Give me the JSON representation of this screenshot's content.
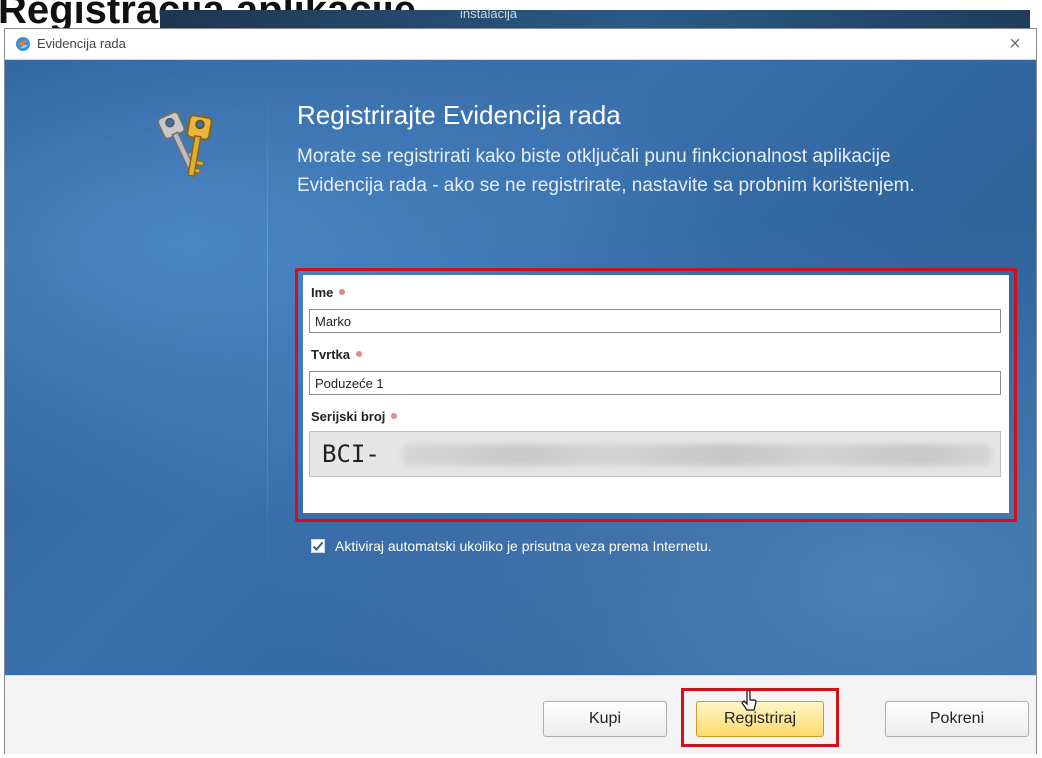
{
  "background": {
    "heading": "Registracija aplikacije",
    "tab_text": "instalacija"
  },
  "window": {
    "title": "Evidencija rada",
    "close_glyph": "×"
  },
  "dialog": {
    "heading": "Registrirajte Evidencija rada",
    "description": "Morate se registrirati kako biste otključali punu finkcionalnost aplikacije Evidencija rada - ako se ne registrirate, nastavite sa probnim korištenjem."
  },
  "form": {
    "name_label": "Ime",
    "name_value": "Marko",
    "company_label": "Tvrtka",
    "company_value": "Poduzeće 1",
    "serial_label": "Serijski broj",
    "serial_prefix": "BCI-"
  },
  "checkbox": {
    "label": "Aktiviraj automatski ukoliko je prisutna veza prema Internetu.",
    "checked": true
  },
  "buttons": {
    "buy": "Kupi",
    "register": "Registriraj",
    "run": "Pokreni"
  },
  "icons": {
    "app": "app-logo-icon",
    "keys": "keys-icon",
    "close": "close-icon",
    "check": "checkmark-icon",
    "cursor": "mouse-cursor-icon"
  },
  "colors": {
    "highlight": "#d0101a",
    "primary_button": "#ffd96b",
    "content_bg": "#3a70ad"
  }
}
